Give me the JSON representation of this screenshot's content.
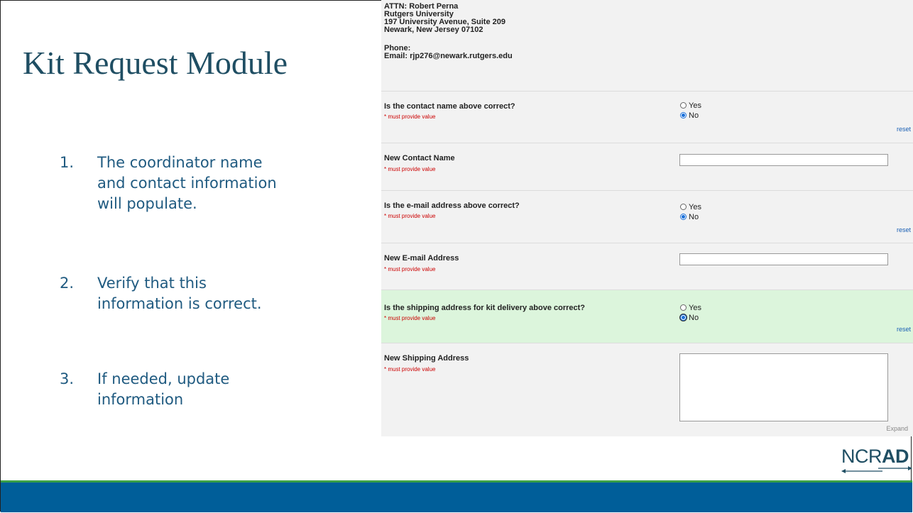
{
  "title": "Kit Request Module",
  "steps": [
    {
      "num": "1.",
      "lines": [
        "The coordinator name",
        "and contact information",
        "will populate."
      ]
    },
    {
      "num": "2.",
      "lines": [
        "Verify that this",
        "information is correct."
      ]
    },
    {
      "num": "3.",
      "lines": [
        "If needed, update",
        "information"
      ]
    }
  ],
  "address": {
    "attn": "ATTN: Robert Perna",
    "org": "Rutgers University",
    "street": "197 University Avenue, Suite 209",
    "city": "Newark, New Jersey 07102",
    "phone": "Phone:",
    "email": "Email: rjp276@newark.rutgers.edu"
  },
  "form": {
    "required_note": "* must provide value",
    "reset_label": "reset",
    "expand_label": "Expand",
    "q_contact": {
      "label": "Is the contact name above correct?",
      "yes": "Yes",
      "no": "No",
      "selected": "No"
    },
    "new_contact": {
      "label": "New Contact Name",
      "value": ""
    },
    "q_email": {
      "label": "Is the e-mail address above correct?",
      "yes": "Yes",
      "no": "No",
      "selected": "No"
    },
    "new_email": {
      "label": "New E-mail Address",
      "value": ""
    },
    "q_shipping": {
      "label": "Is the shipping address for kit delivery above correct?",
      "yes": "Yes",
      "no": "No",
      "selected": "No"
    },
    "new_shipping": {
      "label": "New Shipping Address",
      "value": ""
    }
  },
  "logo": {
    "text_light": "NCR",
    "text_bold": "AD"
  },
  "colors": {
    "accent_blue": "#005e99",
    "accent_green": "#3aa047",
    "highlight_row": "#dcf5dc",
    "required_red": "#cc0000"
  }
}
